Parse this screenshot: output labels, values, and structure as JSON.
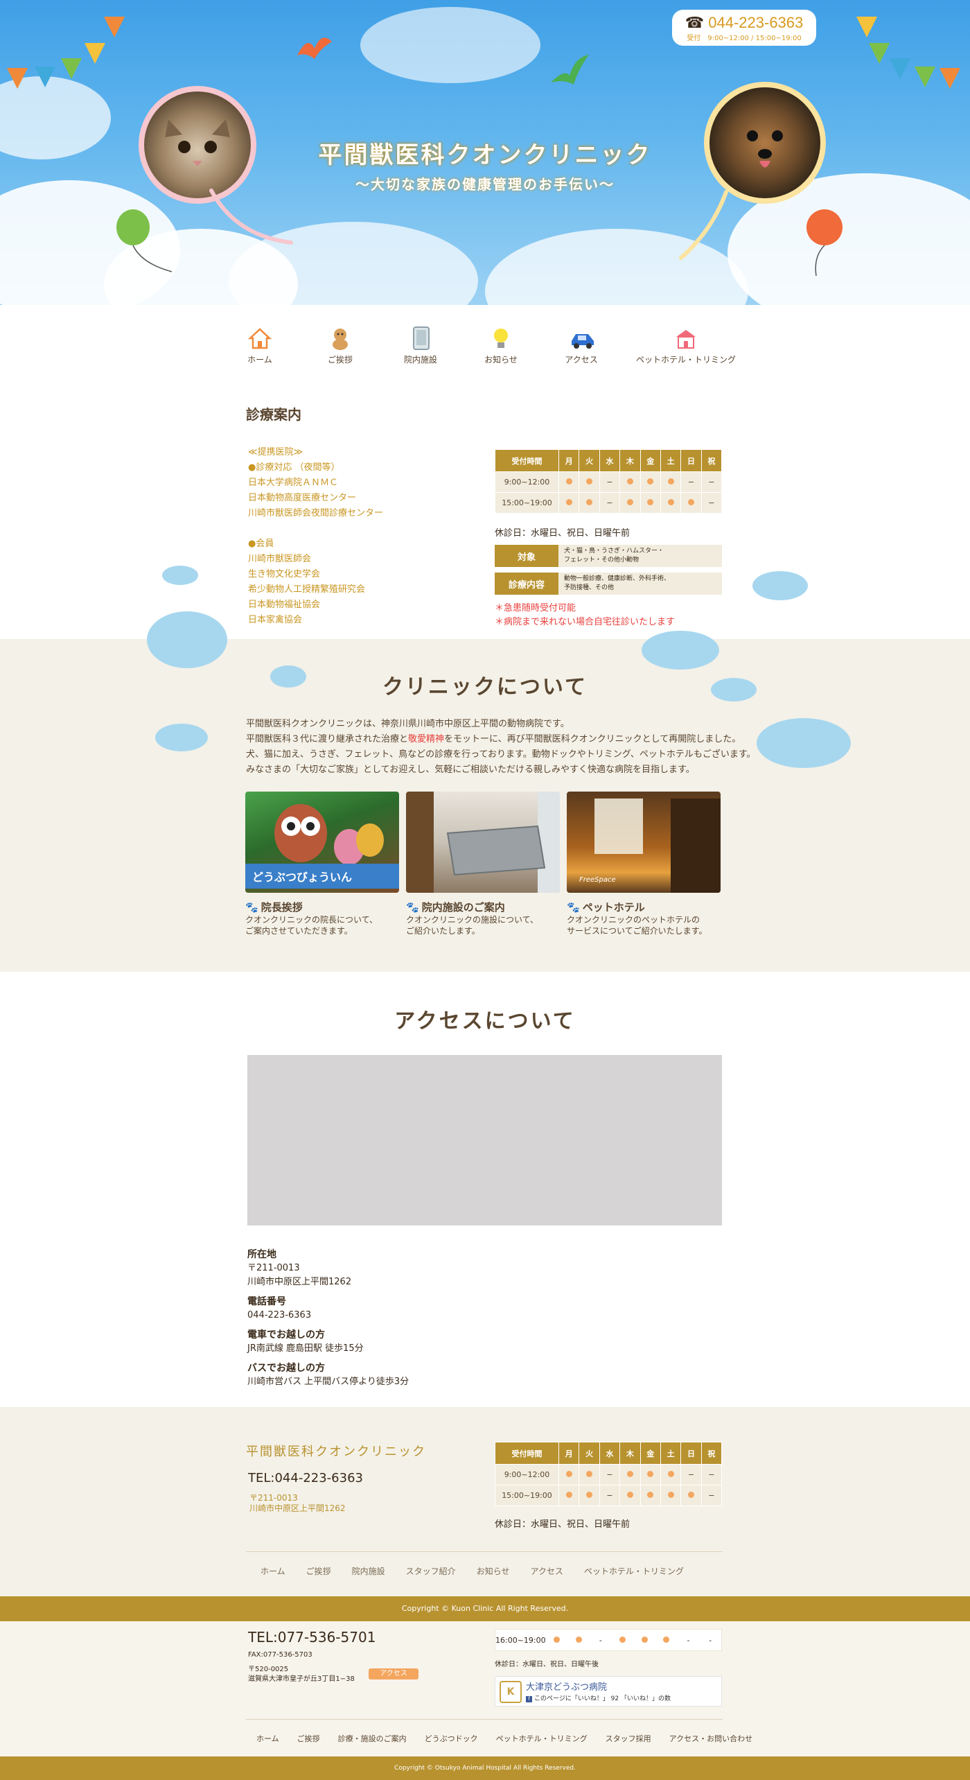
{
  "hero": {
    "title": "平間獣医科クオンクリニック",
    "subtitle": "〜大切な家族の健康管理のお手伝い〜",
    "phone": "044-223-6363",
    "phone_hours": "受付　9:00~12:00 / 15:00~19:00",
    "phone_icon": "phone-icon"
  },
  "nav": {
    "items": [
      {
        "label": "ホーム",
        "icon": "house-icon"
      },
      {
        "label": "ご挨拶",
        "icon": "dog-icon"
      },
      {
        "label": "院内施設",
        "icon": "door-icon"
      },
      {
        "label": "お知らせ",
        "icon": "lightbulb-icon"
      },
      {
        "label": "アクセス",
        "icon": "car-icon"
      },
      {
        "label": "ペットホテル・トリミング",
        "icon": "pet-hotel-icon"
      }
    ]
  },
  "guide": {
    "title": "診療案内",
    "partners": [
      "≪提携医院≫",
      "●診療対応 （夜間等）",
      "日本大学病院ＡＮＭＣ",
      "日本動物高度医療センター",
      "川崎市獣医師会夜間診療センター",
      "",
      "●会員",
      "川崎市獣医師会",
      "生き物文化史学会",
      "希少動物人工授精繁殖研究会",
      "日本動物福祉協会",
      "日本家禽協会"
    ],
    "schedule": {
      "header": [
        "受付時間",
        "月",
        "火",
        "水",
        "木",
        "金",
        "土",
        "日",
        "祝"
      ],
      "rows": [
        {
          "time": "9:00~12:00",
          "cells": [
            "●",
            "●",
            "−",
            "●",
            "●",
            "●",
            "−",
            "−"
          ]
        },
        {
          "time": "15:00~19:00",
          "cells": [
            "●",
            "●",
            "−",
            "●",
            "●",
            "●",
            "●",
            "−"
          ]
        }
      ]
    },
    "closed": "休診日：水曜日、祝日、日曜午前",
    "target_key": "対象",
    "target_val_1": "犬・猫・鳥・うさぎ・ハムスター・",
    "target_val_2": "フェレット・その他小動物",
    "content_key": "診療内容",
    "content_val_1": "動物一般診療、健康診断、外科手術、",
    "content_val_2": "予防接種、その他",
    "note_1": "＊急患随時受付可能",
    "note_2": "＊病院まで来れない場合自宅往診いたします"
  },
  "about": {
    "title": "クリニックについて",
    "line_1": "平間獣医科クオンクリニックは、神奈川県川崎市中原区上平間の動物病院です。",
    "line_2a": "平間獣医科３代に渡り継承された治療と",
    "line_2b": "敬愛精神",
    "line_2c": "をモットーに、再び平間獣医科クオンクリニックとして再開院しました。",
    "line_3": "犬、猫に加え、うさぎ、フェレット、鳥などの診療を行っております。動物ドックやトリミング、ペットホテルもございます。",
    "line_4": "みなさまの「大切なご家族」としてお迎えし、気軽にご相談いただける親しみやすく快適な病院を目指します。",
    "cards": [
      {
        "title": "院長挨拶",
        "desc_1": "クオンクリニックの院長について、",
        "desc_2": "ご案内させていただきます。"
      },
      {
        "title": "院内施設のご案内",
        "desc_1": "クオンクリニックの施設について、",
        "desc_2": "ご紹介いたします。"
      },
      {
        "title": "ペットホテル",
        "desc_1": "クオンクリニックのペットホテルの",
        "desc_2": "サービスについてご紹介いたします。"
      }
    ],
    "card_sign_text": "どうぶつびょういん",
    "card_photo_caption": "FreeSpace"
  },
  "access": {
    "title": "アクセスについて",
    "address_label": "所在地",
    "zip": "〒211-0013",
    "address": "川崎市中原区上平間1262",
    "phone_label": "電話番号",
    "phone": "044-223-6363",
    "train_label": "電車でお越しの方",
    "train": "JR南武線 鹿島田駅 徒歩15分",
    "bus_label": "バスでお越しの方",
    "bus": "川崎市営バス 上平間バス停より徒歩3分"
  },
  "footer": {
    "name": "平間獣医科クオンクリニック",
    "tel": "TEL:044-223-6363",
    "zip": "〒211-0013",
    "address": "川崎市中原区上平間1262",
    "closed": "休診日：水曜日、祝日、日曜午前",
    "links": [
      "ホーム",
      "ご挨拶",
      "院内施設",
      "スタッフ紹介",
      "お知らせ",
      "アクセス",
      "ペットホテル・トリミング"
    ],
    "copyright": "Copyright © Kuon Clinic All Right Reserved."
  },
  "footer2": {
    "tel": "TEL:077-536-5701",
    "fax": "FAX:077-536-5703",
    "zip": "〒520-0025",
    "address": "滋賀県大津市皇子が丘3丁目1−38",
    "access_btn": "アクセス",
    "sched_time": "16:00~19:00",
    "sched_cells": [
      "●",
      "●",
      "-",
      "●",
      "●",
      "●",
      "-",
      "-"
    ],
    "closed": "休診日：水曜日、祝日、日曜午後",
    "fb_name": "大津京どうぶつ病院",
    "fb_like": "このページに「いいね！」 92 「いいね！」の数",
    "fb_logo": "K",
    "links": [
      "ホーム",
      "ご挨拶",
      "診療・施設のご案内",
      "どうぶつドック",
      "ペットホテル・トリミング",
      "スタッフ採用",
      "アクセス・お問い合わせ"
    ],
    "copyright": "Copyright © Otsukyo Animal Hospital All Rights Reserved."
  },
  "colors": {
    "gold": "#b8922f",
    "orange": "#f4a65f",
    "red": "#e8403d",
    "cream": "#f4f1e8"
  }
}
